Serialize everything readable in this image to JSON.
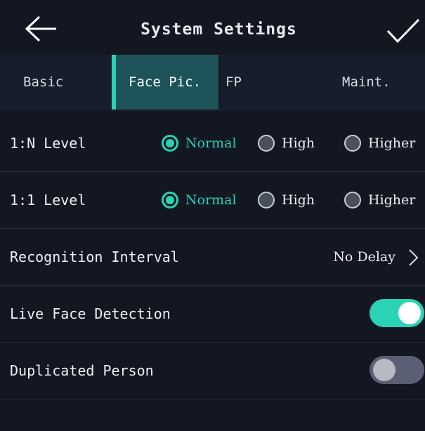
{
  "header": {
    "title": "System Settings",
    "back_icon": "arrow-left-icon",
    "confirm_icon": "checkmark-icon"
  },
  "tabs": [
    {
      "label": "Basic",
      "active": false
    },
    {
      "label": "Face Pic.",
      "active": true
    },
    {
      "label": "FP",
      "active": false
    },
    {
      "label": "Maint.",
      "active": false
    }
  ],
  "settings": {
    "n_level": {
      "label": "1:N Level",
      "options": [
        "Normal",
        "High",
        "Higher"
      ],
      "selected": "Normal"
    },
    "one_level": {
      "label": "1:1 Level",
      "options": [
        "Normal",
        "High",
        "Higher"
      ],
      "selected": "Normal"
    },
    "recognition_interval": {
      "label": "Recognition Interval",
      "value": "No Delay",
      "icon": "chevron-right-icon"
    },
    "live_face_detection": {
      "label": "Live Face Detection",
      "enabled": true
    },
    "duplicated_person": {
      "label": "Duplicated Person",
      "enabled": false
    }
  },
  "colors": {
    "accent": "#2ad3b6",
    "background": "#121722",
    "tab_bar": "#171d2a",
    "active_tab": "#1d5359",
    "toggle_off": "#5a5f73"
  }
}
